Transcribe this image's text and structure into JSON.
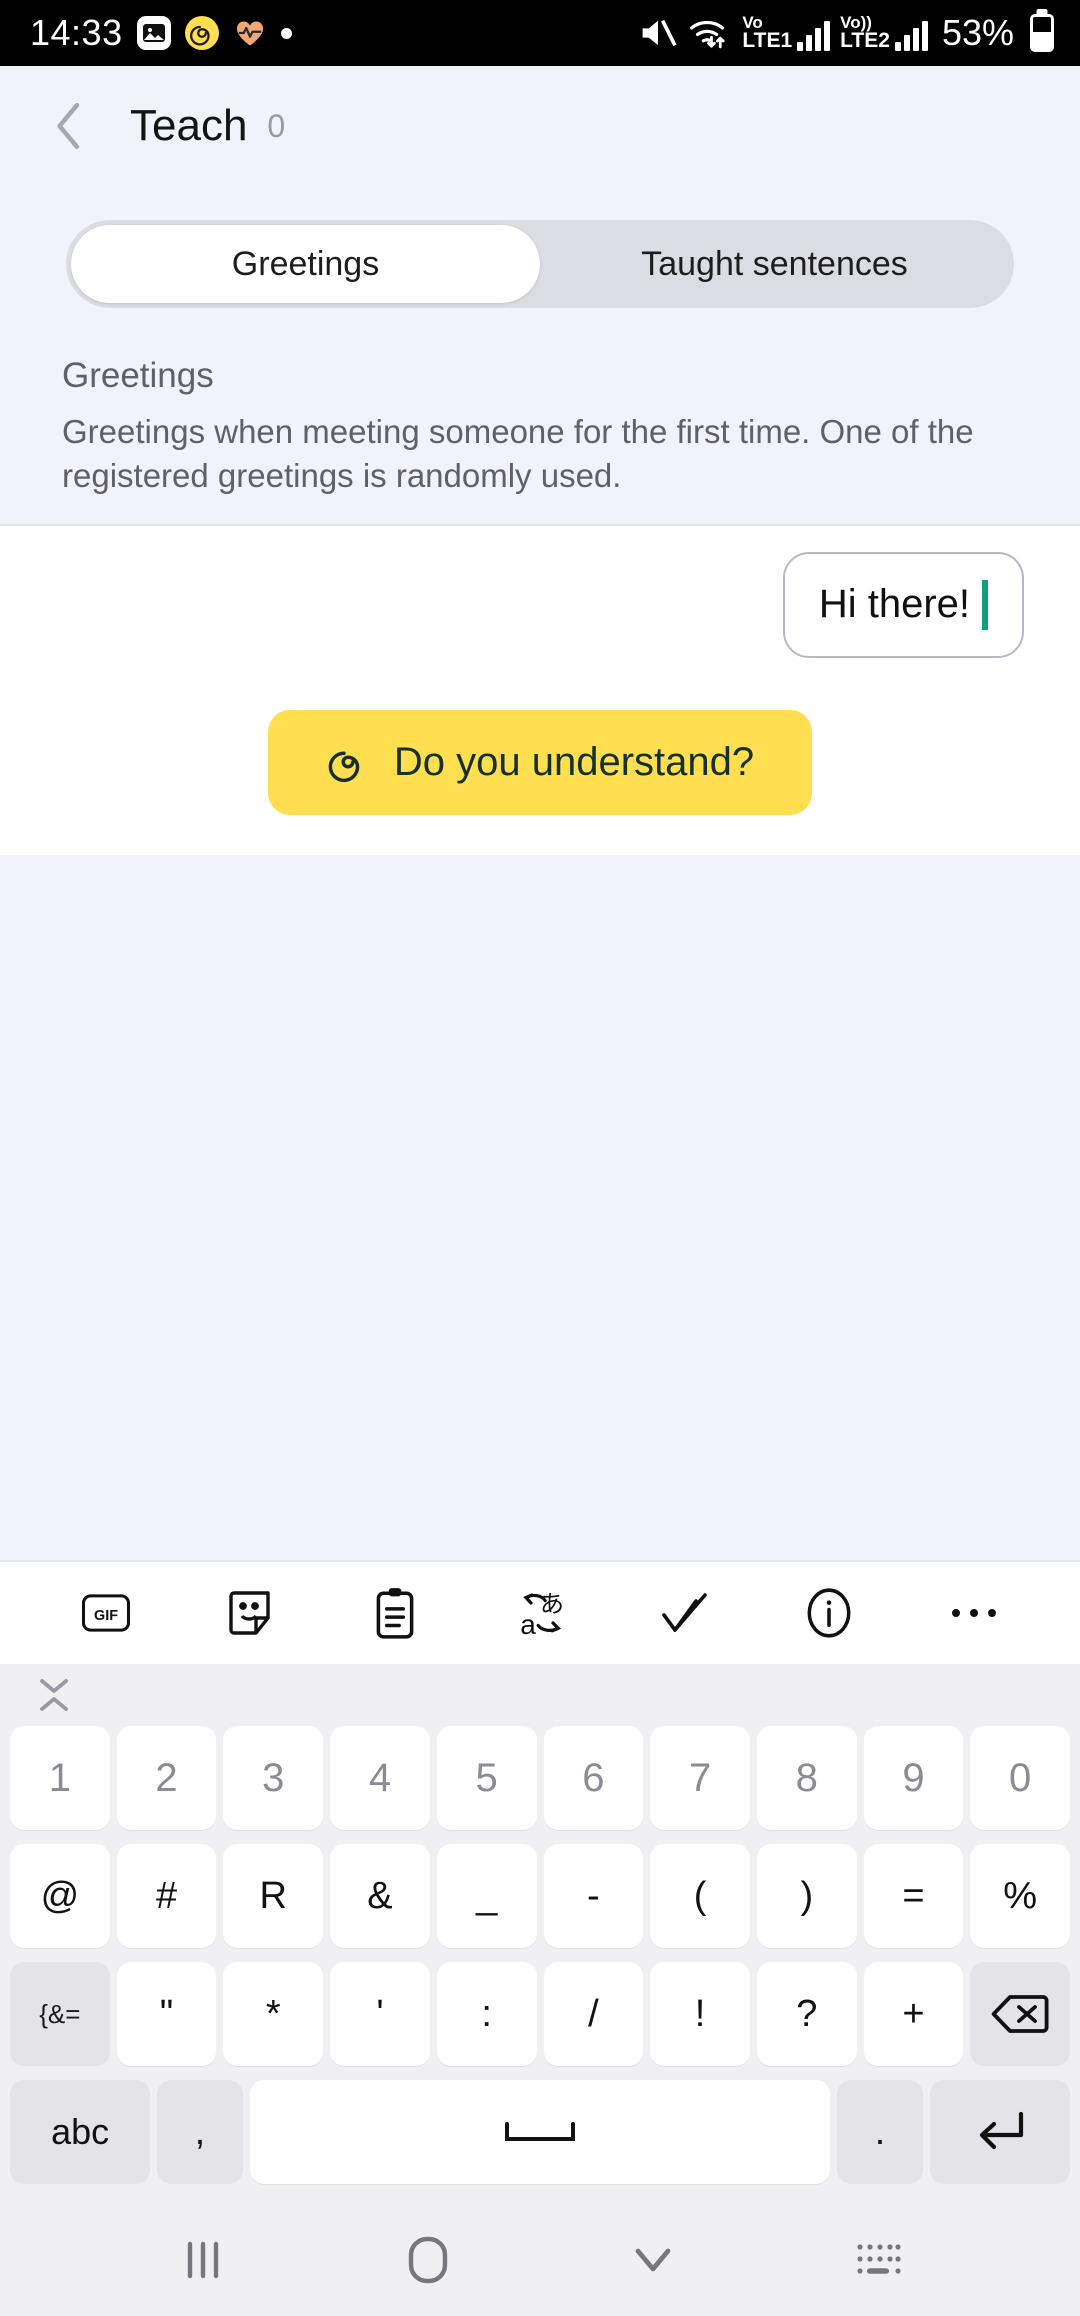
{
  "status_bar": {
    "time": "14:33",
    "battery_percent": "53%",
    "icons": {
      "photos": "photos-icon",
      "spiral_app": "spiral-app-icon",
      "health": "heart-rate-icon",
      "dot": "notification-dot-icon",
      "mute": "volume-mute-icon",
      "wifi": "wifi-transfer-icon",
      "battery": "battery-icon"
    },
    "sim1": {
      "line1": "Vo",
      "line2": "LTE1"
    },
    "sim2": {
      "line1": "Vo))",
      "line2": "LTE2"
    }
  },
  "header": {
    "back_icon": "chevron-left-icon",
    "title": "Teach",
    "count": "0"
  },
  "tabs": [
    {
      "label": "Greetings",
      "active": true
    },
    {
      "label": "Taught sentences",
      "active": false
    }
  ],
  "description": {
    "title": "Greetings",
    "body": "Greetings when meeting someone for the first time. One of the registered greetings is randomly used."
  },
  "composer": {
    "bubble_text": "Hi there!",
    "caret_color": "#11a07e",
    "understand_button": {
      "label": "Do you understand?",
      "icon": "spiral-icon",
      "background": "#ffdf4f"
    }
  },
  "keyboard_toolbar": [
    {
      "name": "gif-icon",
      "label": "GIF"
    },
    {
      "name": "sticker-icon",
      "label": ""
    },
    {
      "name": "clipboard-icon",
      "label": ""
    },
    {
      "name": "translate-icon",
      "label": ""
    },
    {
      "name": "handwriting-icon",
      "label": ""
    },
    {
      "name": "info-icon",
      "label": ""
    },
    {
      "name": "more-options-icon",
      "label": ""
    }
  ],
  "keyboard": {
    "collapse_icon": "collapse-handle-icon",
    "rows": [
      {
        "keys": [
          {
            "label": "1",
            "type": "num"
          },
          {
            "label": "2",
            "type": "num"
          },
          {
            "label": "3",
            "type": "num"
          },
          {
            "label": "4",
            "type": "num"
          },
          {
            "label": "5",
            "type": "num"
          },
          {
            "label": "6",
            "type": "num"
          },
          {
            "label": "7",
            "type": "num"
          },
          {
            "label": "8",
            "type": "num"
          },
          {
            "label": "9",
            "type": "num"
          },
          {
            "label": "0",
            "type": "num"
          }
        ]
      },
      {
        "keys": [
          {
            "label": "@",
            "type": "sym"
          },
          {
            "label": "#",
            "type": "sym"
          },
          {
            "label": "R",
            "type": "sym"
          },
          {
            "label": "&",
            "type": "sym"
          },
          {
            "label": "_",
            "type": "sym"
          },
          {
            "label": "-",
            "type": "sym"
          },
          {
            "label": "(",
            "type": "sym"
          },
          {
            "label": ")",
            "type": "sym"
          },
          {
            "label": "=",
            "type": "sym"
          },
          {
            "label": "%",
            "type": "sym"
          }
        ]
      },
      {
        "keys": [
          {
            "label": "{&=",
            "type": "func-small"
          },
          {
            "label": "\"",
            "type": "sym"
          },
          {
            "label": "*",
            "type": "sym"
          },
          {
            "label": "'",
            "type": "sym"
          },
          {
            "label": ":",
            "type": "sym"
          },
          {
            "label": "/",
            "type": "sym"
          },
          {
            "label": "!",
            "type": "sym"
          },
          {
            "label": "?",
            "type": "sym"
          },
          {
            "label": "+",
            "type": "sym"
          },
          {
            "label": "",
            "type": "backspace"
          }
        ]
      },
      {
        "keys": [
          {
            "label": "abc",
            "type": "abc"
          },
          {
            "label": ",",
            "type": "narrow"
          },
          {
            "label": "",
            "type": "space"
          },
          {
            "label": ".",
            "type": "narrow"
          },
          {
            "label": "",
            "type": "enter"
          }
        ]
      }
    ]
  },
  "nav_bar": [
    {
      "name": "recents-icon"
    },
    {
      "name": "home-icon"
    },
    {
      "name": "hide-keyboard-icon"
    },
    {
      "name": "keyboard-switch-icon"
    }
  ]
}
